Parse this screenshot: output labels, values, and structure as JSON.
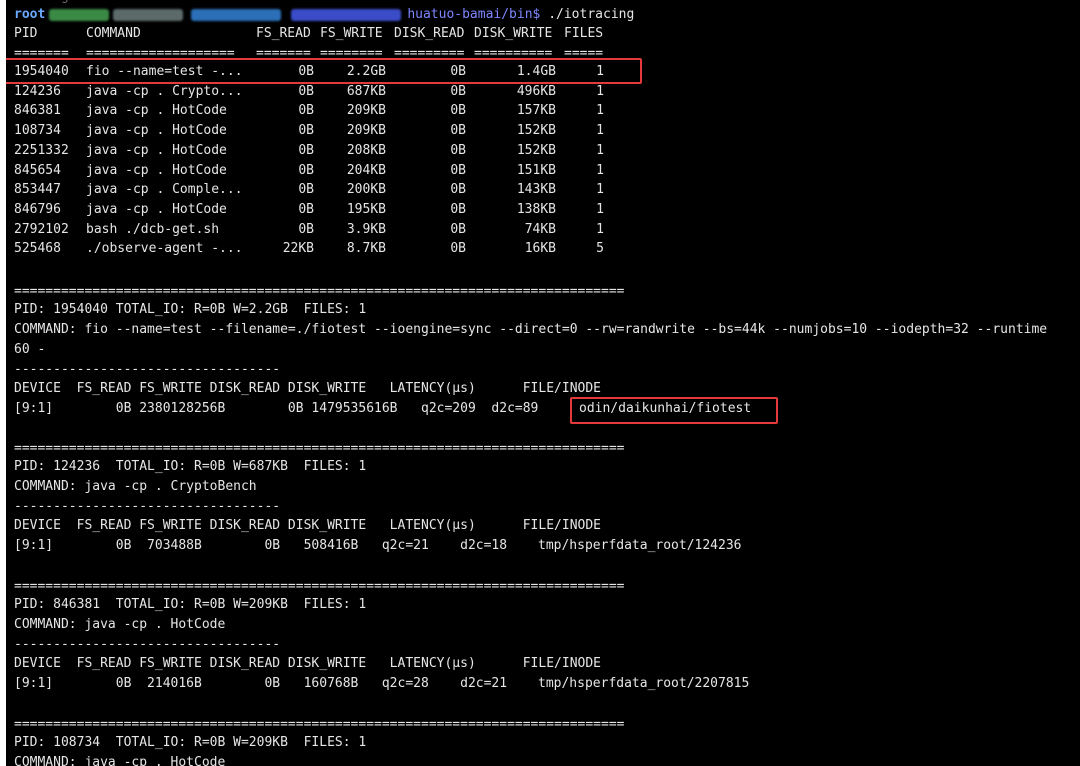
{
  "prompt": {
    "user": "root",
    "path": "huatuo-bamai/bin$",
    "command": "./iotracing"
  },
  "top_faint": "tracingl",
  "summary": {
    "headers": [
      "PID",
      "COMMAND",
      "FS_READ",
      "FS_WRITE",
      "DISK_READ",
      "DISK_WRITE",
      "FILES"
    ],
    "separators": [
      "=======",
      "===================",
      "=======",
      "========",
      "=========",
      "==========",
      "====="
    ],
    "rows": [
      [
        "1954040",
        "fio --name=test -...",
        "0B",
        "2.2GB",
        "0B",
        "1.4GB",
        "1"
      ],
      [
        "124236",
        "java -cp . Crypto...",
        "0B",
        "687KB",
        "0B",
        "496KB",
        "1"
      ],
      [
        "846381",
        "java -cp . HotCode",
        "0B",
        "209KB",
        "0B",
        "157KB",
        "1"
      ],
      [
        "108734",
        "java -cp . HotCode",
        "0B",
        "209KB",
        "0B",
        "152KB",
        "1"
      ],
      [
        "2251332",
        "java -cp . HotCode",
        "0B",
        "208KB",
        "0B",
        "152KB",
        "1"
      ],
      [
        "845654",
        "java -cp . HotCode",
        "0B",
        "204KB",
        "0B",
        "151KB",
        "1"
      ],
      [
        "853447",
        "java -cp . Comple...",
        "0B",
        "200KB",
        "0B",
        "143KB",
        "1"
      ],
      [
        "846796",
        "java -cp . HotCode",
        "0B",
        "195KB",
        "0B",
        "138KB",
        "1"
      ],
      [
        "2792102",
        "bash ./dcb-get.sh",
        "0B",
        "3.9KB",
        "0B",
        "74KB",
        "1"
      ],
      [
        "525468",
        "./observe-agent -...",
        "22KB",
        "8.7KB",
        "0B",
        "16KB",
        "5"
      ]
    ]
  },
  "separator_long": "==============================================================================",
  "separator_short": "----------------------------------",
  "detail_header": "DEVICE  FS_READ FS_WRITE DISK_READ DISK_WRITE   LATENCY(μs)      FILE/INODE",
  "details": [
    {
      "pid_line": "PID: 1954040 TOTAL_IO: R=0B W=2.2GB  FILES: 1",
      "command_line": "COMMAND: fio --name=test --filename=./fiotest --ioengine=sync --direct=0 --rw=randwrite --bs=44k --numjobs=10 --iodepth=32 --runtime",
      "command_cont": "60 -",
      "data_line": "[9:1]        0B 2380128256B        0B 1479535616B   q2c=209  d2c=89",
      "file": "odin/daikunhai/fiotest"
    },
    {
      "pid_line": "PID: 124236  TOTAL_IO: R=0B W=687KB  FILES: 1",
      "command_line": "COMMAND: java -cp . CryptoBench",
      "data_line": "[9:1]        0B  703488B        0B   508416B   q2c=21    d2c=18",
      "file": "tmp/hsperfdata_root/124236"
    },
    {
      "pid_line": "PID: 846381  TOTAL_IO: R=0B W=209KB  FILES: 1",
      "command_line": "COMMAND: java -cp . HotCode",
      "data_line": "[9:1]        0B  214016B        0B   160768B   q2c=28    d2c=21",
      "file": "tmp/hsperfdata_root/2207815"
    },
    {
      "pid_line": "PID: 108734  TOTAL_IO: R=0B W=209KB  FILES: 1",
      "command_line": "COMMAND: java -cp . HotCode"
    }
  ],
  "colors": {
    "background": "#000000",
    "text": "#e6e6e6",
    "highlight": "#e5393b",
    "prompt_user": "#6aa9ff",
    "prompt_path": "#7d86ff"
  }
}
